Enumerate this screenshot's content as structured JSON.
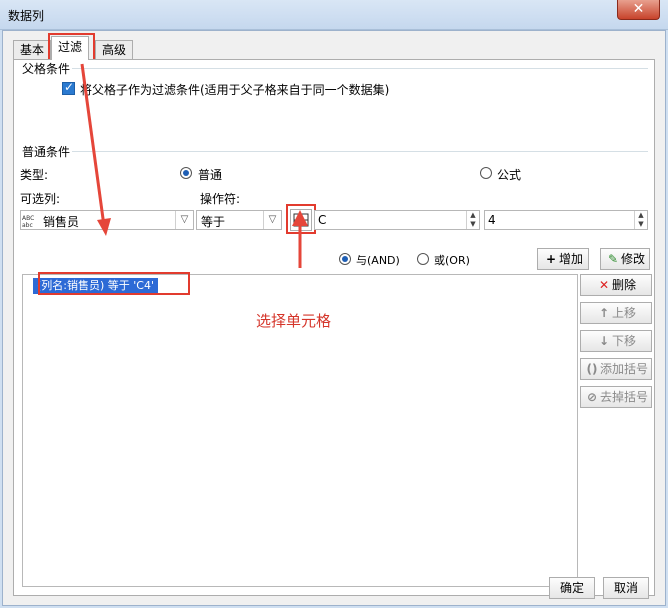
{
  "window": {
    "title": "数据列",
    "close_glyph": "✕"
  },
  "tabs": [
    {
      "label": "基本"
    },
    {
      "label": "过滤"
    },
    {
      "label": "高级"
    }
  ],
  "parent_condition": {
    "section_label": "父格条件",
    "checkbox_label": "将父格子作为过滤条件(适用于父子格来自于同一个数据集)",
    "checked": true
  },
  "normal_condition": {
    "section_label": "普通条件",
    "type_label": "类型:",
    "type_normal": "普通",
    "type_formula": "公式",
    "selected_type": "普通",
    "column_label": "可选列:",
    "operator_label": "操作符:",
    "column_value": "销售员",
    "operator_value": "等于",
    "value1": "C",
    "value2": "4"
  },
  "logic": {
    "and_label": "与(AND)",
    "or_label": "或(OR)",
    "selected": "与(AND)"
  },
  "buttons": {
    "add": "增加",
    "modify": "修改",
    "delete": "删除",
    "up": "上移",
    "down": "下移",
    "add_bracket": "添加括号",
    "remove_bracket": "去掉括号",
    "ok": "确定",
    "cancel": "取消"
  },
  "conditions": [
    {
      "text": "(列名:销售员) 等于 'C4'"
    }
  ],
  "annotation": {
    "text": "选择单元格",
    "color": "#d5352a"
  }
}
